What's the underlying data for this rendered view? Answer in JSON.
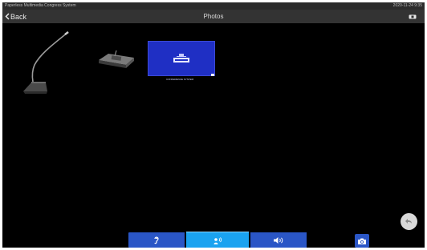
{
  "status_bar": {
    "app_name": "Paperless Multimedia Congress System",
    "datetime": "2020-11-24 9:35"
  },
  "nav": {
    "back_label": "Back",
    "title": "Photos"
  },
  "photos": [
    {
      "name": "gooseneck-microphone"
    },
    {
      "name": "delegate-unit"
    },
    {
      "name": "screen-capture",
      "caption": "CONFERENCE SYSTEM"
    }
  ],
  "bottom_bar": {
    "buttons": [
      {
        "icon": "ear-icon",
        "active": false
      },
      {
        "icon": "speak-icon",
        "active": true
      },
      {
        "icon": "speaker-icon",
        "active": false
      }
    ]
  },
  "colors": {
    "bar_blue": "#2a56c6",
    "active_blue": "#1aa3f0",
    "background": "#000000",
    "header": "#333333"
  }
}
